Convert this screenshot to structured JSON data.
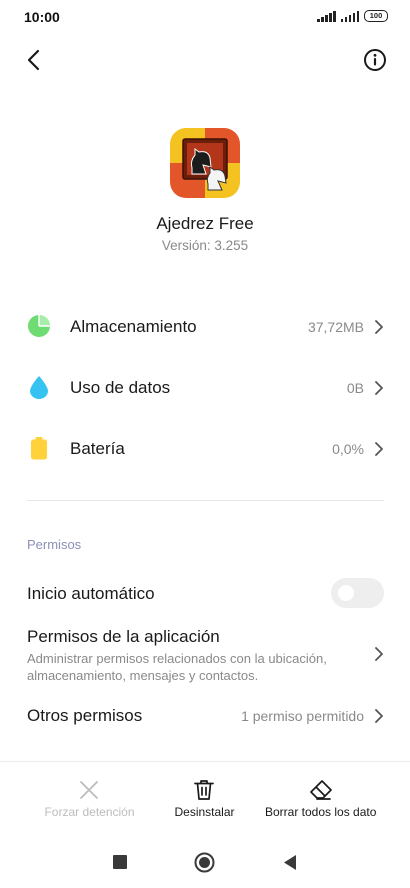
{
  "status_bar": {
    "time": "10:00",
    "battery_level": "100"
  },
  "app": {
    "name": "Ajedrez Free",
    "version": "Versión: 3.255"
  },
  "rows": [
    {
      "label": "Almacenamiento",
      "value": "37,72MB",
      "icon": "pie-chart-icon",
      "color": "#6edb73"
    },
    {
      "label": "Uso de datos",
      "value": "0B",
      "icon": "water-drop-icon",
      "color": "#36c3f2"
    },
    {
      "label": "Batería",
      "value": "0,0%",
      "icon": "battery-icon",
      "color": "#ffd23b"
    }
  ],
  "permissions": {
    "header": "Permisos",
    "autostart_label": "Inicio automático",
    "autostart_enabled": false,
    "app_permissions_label": "Permisos de la aplicación",
    "app_permissions_desc": "Administrar permisos relacionados con la ubicación, almacenamiento, mensajes y contactos.",
    "other_label": "Otros permisos",
    "other_value": "1 permiso permitido"
  },
  "actions": [
    {
      "label": "Forzar detención",
      "icon": "close-icon",
      "enabled": false
    },
    {
      "label": "Desinstalar",
      "icon": "trash-icon",
      "enabled": true
    },
    {
      "label": "Borrar todos los datos",
      "icon": "eraser-icon",
      "enabled": true
    }
  ]
}
